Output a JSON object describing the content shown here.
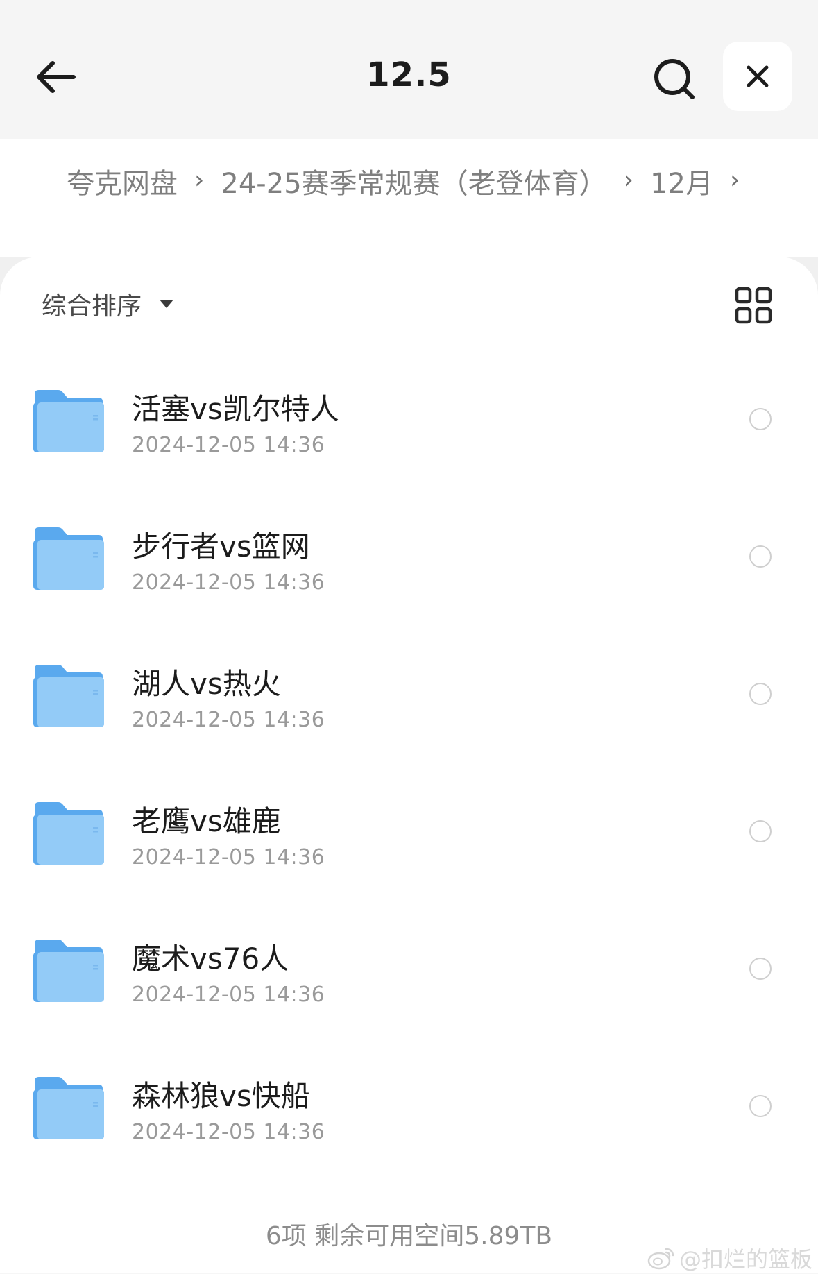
{
  "header": {
    "title": "12.5",
    "back_icon": "arrow-left-icon",
    "search_icon": "search-icon",
    "close_icon": "close-icon"
  },
  "breadcrumb": [
    {
      "label": "夸克网盘"
    },
    {
      "label": "24-25赛季常规赛（老登体育）"
    },
    {
      "label": "12月"
    }
  ],
  "toolbar": {
    "sort_label": "综合排序",
    "view_icon": "grid-view-icon"
  },
  "files": [
    {
      "name": "活塞vs凯尔特人",
      "date": "2024-12-05 14:36"
    },
    {
      "name": "步行者vs篮网",
      "date": "2024-12-05 14:36"
    },
    {
      "name": "湖人vs热火",
      "date": "2024-12-05 14:36"
    },
    {
      "name": "老鹰vs雄鹿",
      "date": "2024-12-05 14:36"
    },
    {
      "name": "魔术vs76人",
      "date": "2024-12-05 14:36"
    },
    {
      "name": "森林狼vs快船",
      "date": "2024-12-05 14:36"
    }
  ],
  "footer": {
    "summary": "6项  剩余可用空间5.89TB"
  },
  "watermark": {
    "text": "@扣烂的篮板"
  },
  "colors": {
    "folder_main": "#8cc6f5",
    "folder_back": "#5aa9ee",
    "text_primary": "#1c1c1c",
    "text_secondary": "#9a9a9a"
  }
}
